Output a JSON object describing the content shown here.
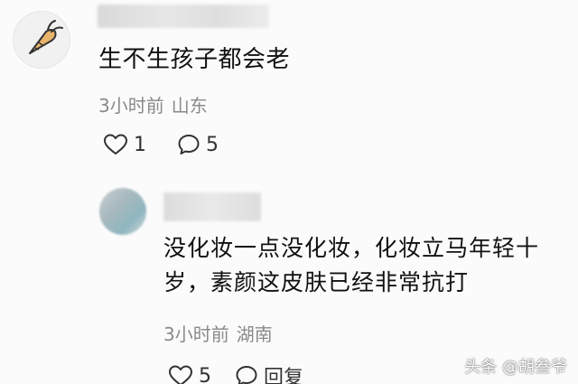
{
  "comment": {
    "text": "生不生孩子都会老",
    "time": "3小时前",
    "location": "山东",
    "like_count": "1",
    "reply_count": "5"
  },
  "reply": {
    "text": "没化妆一点没化妆，化妆立马年轻十岁，素颜这皮肤已经非常抗打",
    "time": "3小时前",
    "location": "湖南",
    "like_count": "5",
    "reply_label": "回复"
  },
  "watermark": "头条 @胡叁爷",
  "icons": {
    "avatar": "carrot-avatar-icon",
    "like": "heart-outline-icon",
    "comment": "speech-bubble-icon"
  },
  "colors": {
    "background": "#fbfbfb",
    "text": "#111111",
    "meta": "#8a8a8a",
    "avatar_carrot": "#e8b36a"
  }
}
